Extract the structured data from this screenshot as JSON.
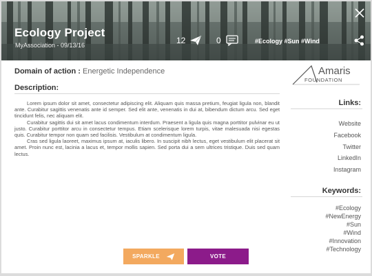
{
  "header": {
    "title": "Ecology Project",
    "subtitle": "MyAssociation - 09/13/16",
    "sparkle_count": "12",
    "comment_count": "0",
    "hashtags": "#Ecology #Sun #Wind",
    "icons": {
      "sparkle": "paper-plane-icon",
      "comment": "comment-icon",
      "share": "share-icon",
      "close": "close-icon"
    }
  },
  "details": {
    "domain_label": "Domain of action :",
    "domain_value": "Energetic Independence",
    "description_label": "Description:",
    "paragraphs": [
      "Lorem ipsum dolor sit amet, consectetur adipiscing elit. Aliquam quis massa pretium, feugiat ligula non, blandit ante. Curabitur sagittis venenatis ante id semper. Sed elit ante, venenatis in dui at, bibendum dictum arcu. Sed eget tincidunt felis, nec aliquam elit.",
      "Curabitur sagittis dui sit amet lacus condimentum interdum. Praesent a ligula quis magna porttitor pulvinar eu ut justo. Curabitur porttitor arcu in consectetur tempus. Etiam scelerisque lorem turpis, vitae malesuada nisi egestas quis. Curabitur tempor non quam sed facilisis. Vestibulum at condimentum ligula.",
      "Cras sed ligula laoreet, maximus ipsum at, iaculis libero. In suscipit nibh lectus, eget vestibulum elit placerat sit amet. Proin nunc est, lacinia a lacus et, tempor mollis sapien. Sed porta dui a sem ultrices tristique. Duis sed quam lectus."
    ]
  },
  "sidebar": {
    "logo_line1": "Amaris",
    "logo_line2": "FOUNDATION",
    "links_label": "Links:",
    "links": [
      "Website",
      "Facebook",
      "Twitter",
      "LinkedIn",
      "Instagram"
    ],
    "keywords_label": "Keywords:",
    "keywords": [
      "#Ecology",
      "#NewEnergy",
      "#Sun",
      "#Wind",
      "#Innovation",
      "#Technology"
    ]
  },
  "actions": {
    "sparkle_label": "SPARKLE",
    "vote_label": "VOTE"
  },
  "colors": {
    "sparkle_button": "#f3a95f",
    "vote_button": "#8c1b8a"
  }
}
